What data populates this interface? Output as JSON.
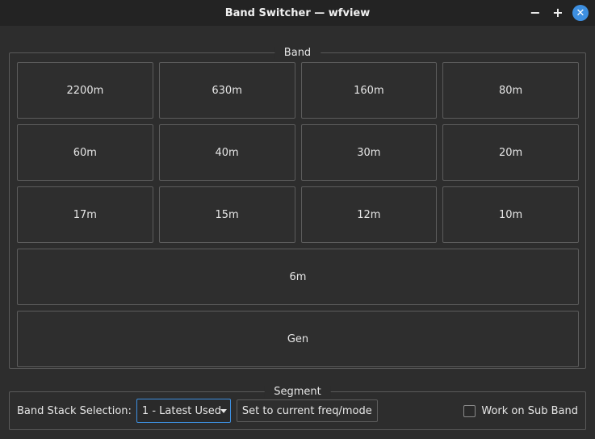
{
  "window": {
    "title": "Band Switcher — wfview",
    "minimize_glyph": "−",
    "maximize_glyph": "+",
    "close_glyph": "✕"
  },
  "band_group": {
    "title": "Band",
    "buttons": [
      "2200m",
      "630m",
      "160m",
      "80m",
      "60m",
      "40m",
      "30m",
      "20m",
      "17m",
      "15m",
      "12m",
      "10m"
    ],
    "wide_buttons": [
      "6m",
      "Gen"
    ]
  },
  "segment_group": {
    "title": "Segment",
    "band_stack_label": "Band Stack Selection:",
    "band_stack_value": "1 - Latest Used",
    "set_current_label": "Set to current freq/mode",
    "sub_band_label": "Work on Sub Band",
    "sub_band_checked": false
  },
  "colors": {
    "accent": "#3d8fe0",
    "background": "#2d2d2d"
  }
}
